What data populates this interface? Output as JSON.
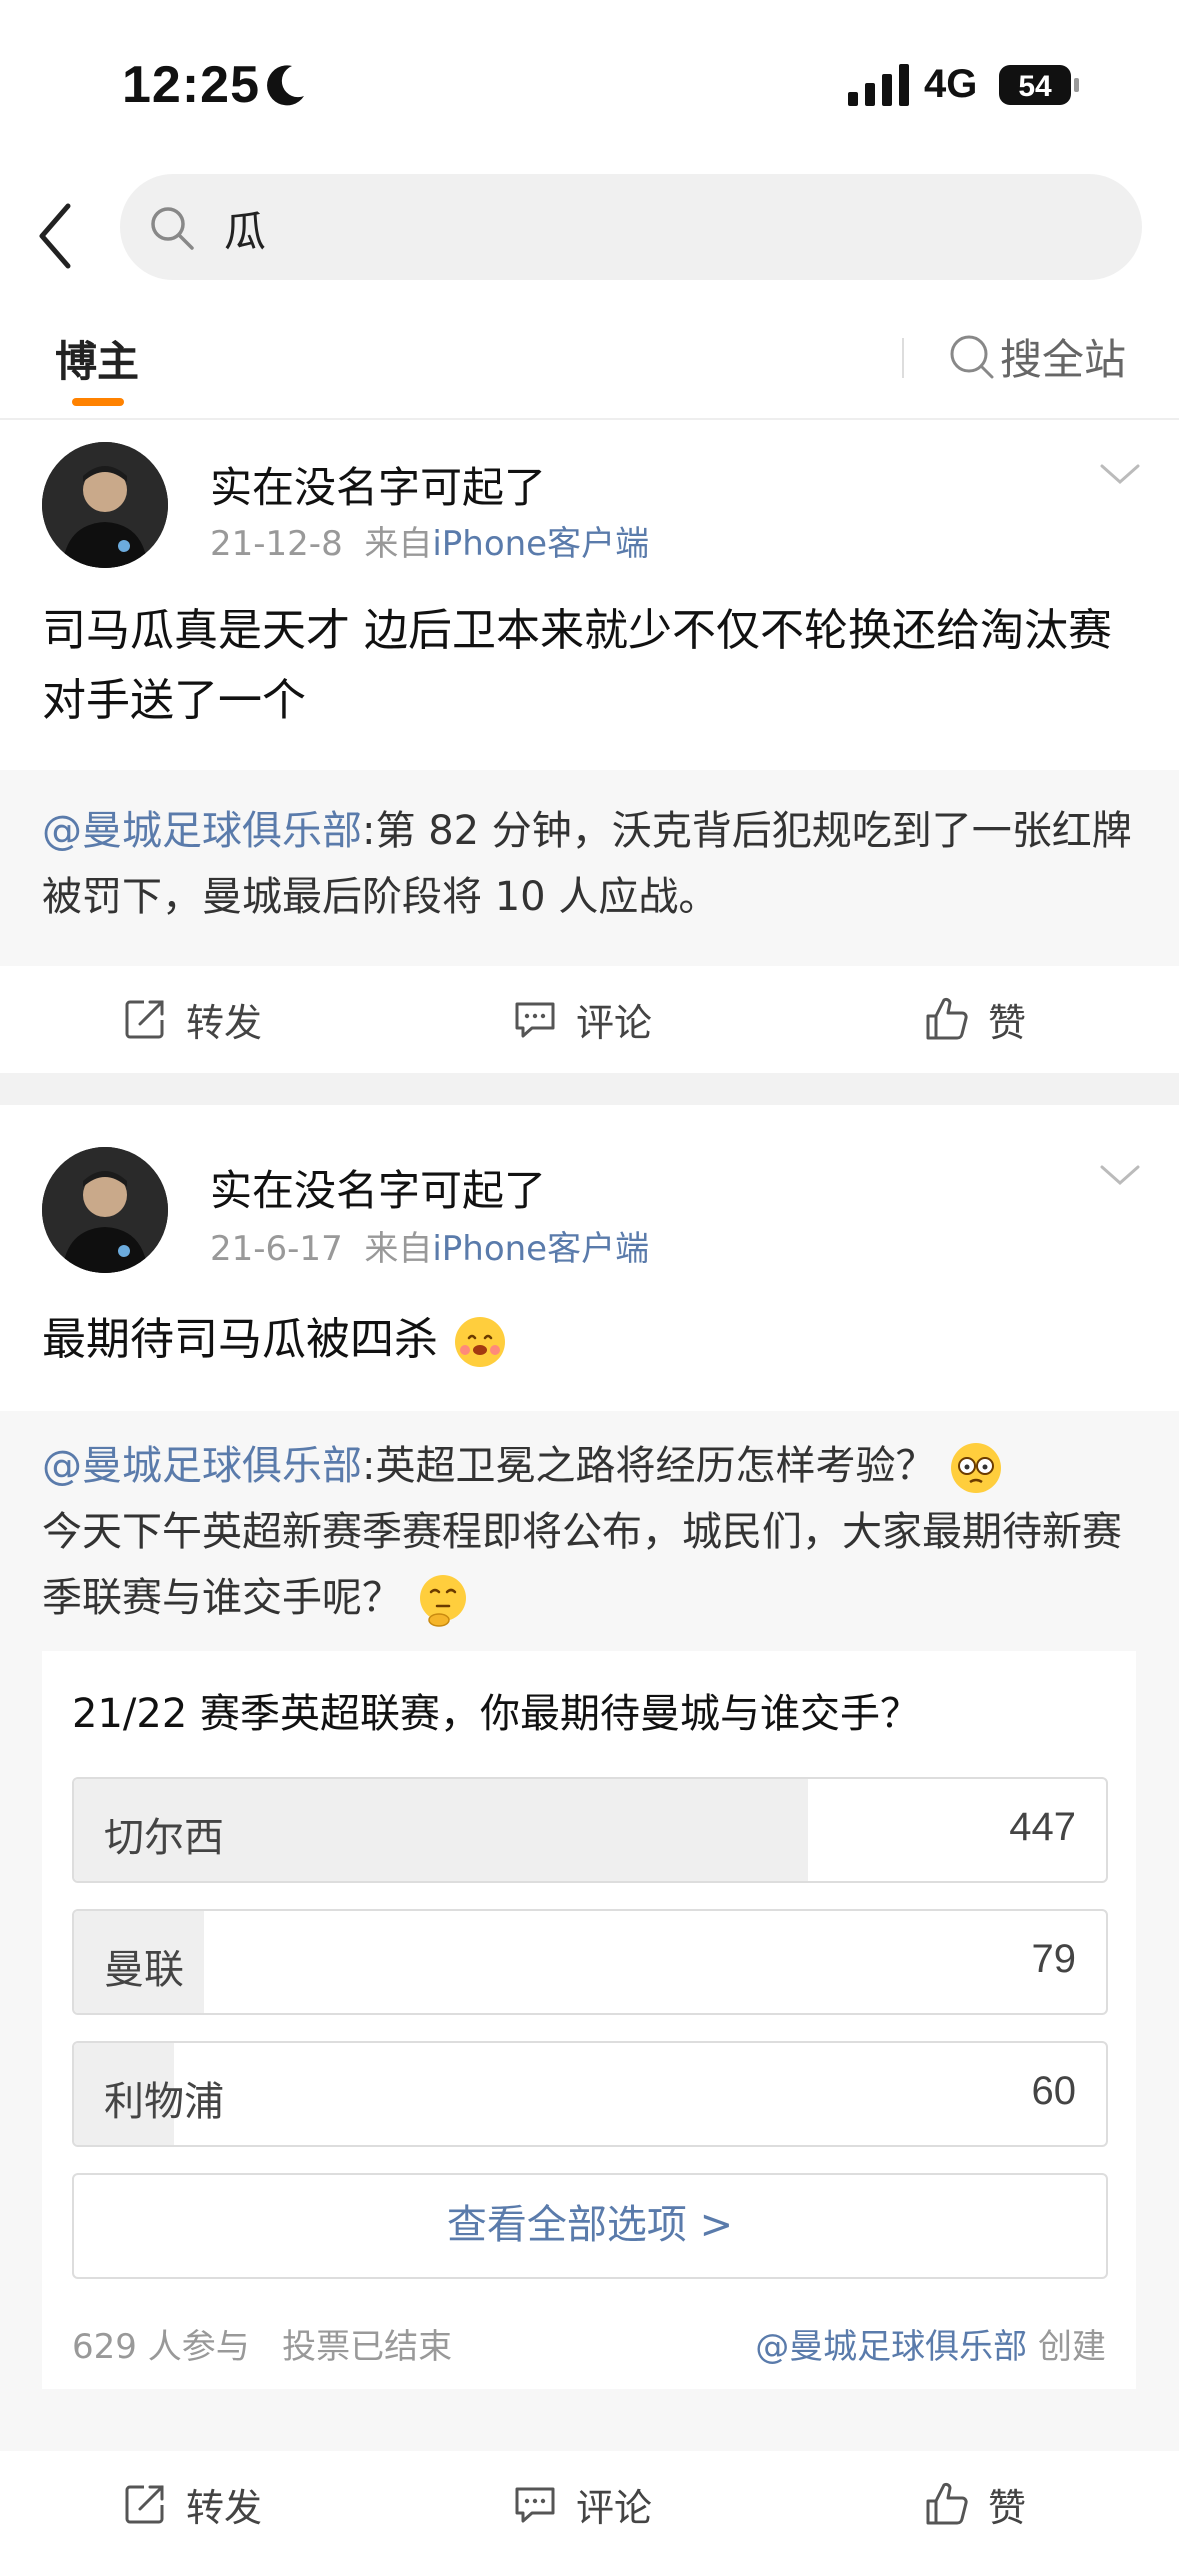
{
  "status": {
    "time": "12:25",
    "network": "4G",
    "battery": "54"
  },
  "search": {
    "query": "瓜"
  },
  "tabs": {
    "active": "博主",
    "search_all": "搜全站"
  },
  "posts": [
    {
      "author": "实在没名字可起了",
      "date": "21-12-8",
      "source_prefix": "来自",
      "source": "iPhone客户端",
      "content": "司马瓜真是天才 边后卫本来就少不仅不轮换还给淘汰赛对手送了一个",
      "repost": {
        "at": "@曼城足球俱乐部",
        "text": ":第 82 分钟，沃克背后犯规吃到了一张红牌被罚下，曼城最后阶段将 10 人应战。"
      },
      "actions": {
        "forward": "转发",
        "comment": "评论",
        "like": "赞"
      }
    },
    {
      "author": "实在没名字可起了",
      "date": "21-6-17",
      "source_prefix": "来自",
      "source": "iPhone客户端",
      "content": "最期待司马瓜被四杀",
      "repost": {
        "at": "@曼城足球俱乐部",
        "text_1": ":英超卫冕之路将经历怎样考验？",
        "text_2": "今天下午英超新赛季赛程即将公布，城民们，大家最期待新赛季联赛与谁交手呢？"
      },
      "poll": {
        "title": "21/22 赛季英超联赛，你最期待曼城与谁交手？",
        "options": [
          {
            "label": "切尔西",
            "count": "447",
            "fraction": 0.711
          },
          {
            "label": "曼联",
            "count": "79",
            "fraction": 0.126
          },
          {
            "label": "利物浦",
            "count": "60",
            "fraction": 0.097
          }
        ],
        "view_all": "查看全部选项 >",
        "participants": "629 人参与",
        "status": "投票已结束",
        "creator": "@曼城足球俱乐部",
        "created": "创建"
      },
      "actions": {
        "forward": "转发",
        "comment": "评论",
        "like": "赞"
      }
    }
  ],
  "icons": {
    "back": "back-chevron-icon",
    "search": "search-icon",
    "forward": "forward-icon",
    "comment": "comment-icon",
    "like": "like-icon",
    "dropdown": "chevron-down-icon"
  },
  "colors": {
    "accent": "#ff8200",
    "link": "#5a7bab"
  }
}
